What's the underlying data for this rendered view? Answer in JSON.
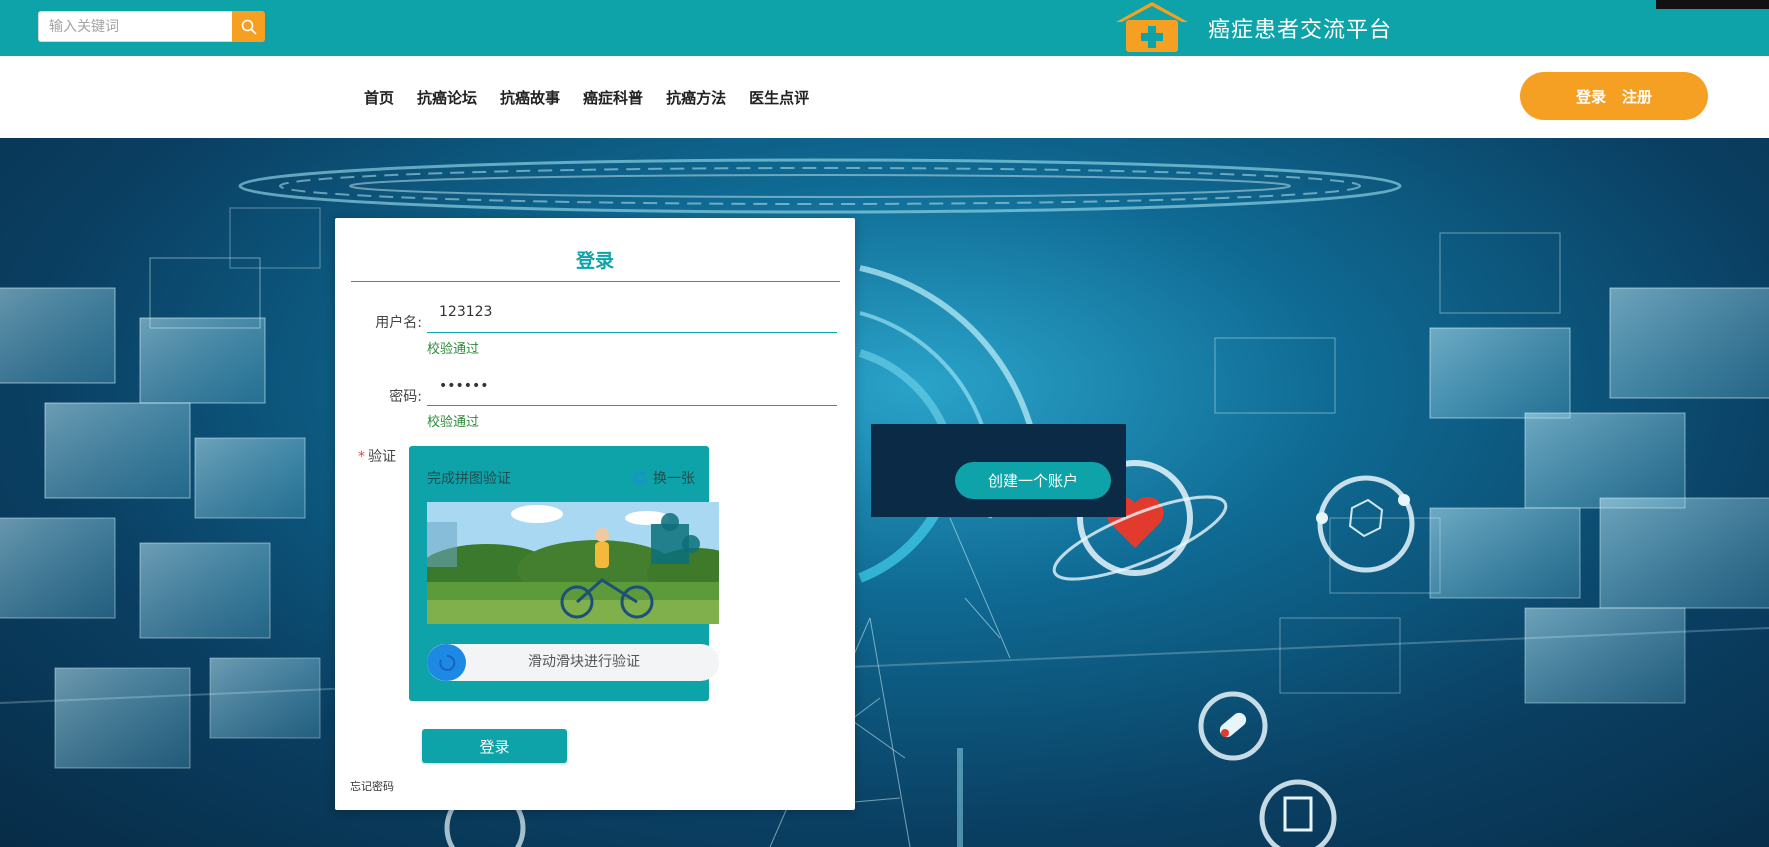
{
  "header": {
    "search": {
      "placeholder": "输入关键词",
      "value": ""
    },
    "brand_title": "癌症患者交流平台"
  },
  "nav": {
    "items": [
      "首页",
      "抗癌论坛",
      "抗癌故事",
      "癌症科普",
      "抗癌方法",
      "医生点评"
    ],
    "login_label": "登录",
    "register_label": "注册"
  },
  "login": {
    "title": "登录",
    "username": {
      "label": "用户名:",
      "value": "123123",
      "status": "校验通过"
    },
    "password": {
      "label": "密码:",
      "value": "••••••",
      "status": "校验通过"
    },
    "captcha": {
      "label": "验证",
      "required_mark": "*",
      "title": "完成拼图验证",
      "refresh_label": "换一张",
      "slider_text": "滑动滑块进行验证"
    },
    "submit_label": "登录",
    "forgot_label": "忘记密码"
  },
  "register": {
    "button_label": "创建一个账户"
  },
  "colors": {
    "primary": "#0ea3a8",
    "accent": "#f5a023",
    "slider_knob": "#1e88e5",
    "ok_text": "#2e8b3a"
  }
}
